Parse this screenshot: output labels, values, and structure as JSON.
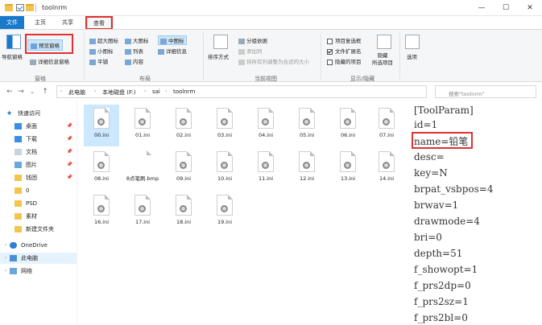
{
  "window": {
    "title": "toolnrm",
    "minimize": "—",
    "maximize": "☐",
    "close": "✕"
  },
  "ribbon_tabs": [
    {
      "label": "文件"
    },
    {
      "label": "主页"
    },
    {
      "label": "共享"
    },
    {
      "label": "查看"
    }
  ],
  "ribbon": {
    "panes": {
      "nav_pane": "导航窗格",
      "preview_pane": "预览窗格",
      "details_pane": "详细信息窗格",
      "group_label": "窗格"
    },
    "layout": {
      "xl_icons": "超大图标",
      "large_icons": "大图标",
      "medium_icons": "中图标",
      "small_icons": "小图标",
      "list": "列表",
      "details": "详细信息",
      "tiles": "平铺",
      "content": "内容",
      "group_label": "布局"
    },
    "current_view": {
      "sort_by": "排序方式",
      "group_by": "分组依据",
      "add_columns": "添加列",
      "size_all_columns": "将所有列调整为合适的大小",
      "group_label": "当前视图"
    },
    "show_hide": {
      "item_checkboxes": "项目复选框",
      "file_extensions": "文件扩展名",
      "hidden_items": "隐藏的项目",
      "hide_selected": "隐藏\n所选项目",
      "group_label": "显示/隐藏"
    },
    "options": "选项"
  },
  "address": {
    "crumbs": [
      "此电脑",
      "本地磁盘 (F:)",
      "sai",
      "toolnrm"
    ],
    "search_placeholder": "搜索\"toolnrm\""
  },
  "sidebar": {
    "items": [
      {
        "label": "快速访问",
        "pin": ""
      },
      {
        "label": "桌面",
        "pin": "📌"
      },
      {
        "label": "下载",
        "pin": "📌"
      },
      {
        "label": "文档",
        "pin": "📌"
      },
      {
        "label": "图片",
        "pin": "📌"
      },
      {
        "label": "钱团",
        "pin": "📌"
      },
      {
        "label": "0",
        "pin": ""
      },
      {
        "label": "PSD",
        "pin": ""
      },
      {
        "label": "素材",
        "pin": ""
      },
      {
        "label": "新建文件夹",
        "pin": ""
      },
      {
        "label": "OneDrive",
        "pin": ""
      },
      {
        "label": "此电脑",
        "pin": ""
      },
      {
        "label": "网络",
        "pin": ""
      }
    ]
  },
  "files": [
    "00.ini",
    "01.ini",
    "02.ini",
    "03.ini",
    "04.ini",
    "05.ini",
    "06.ini",
    "07.ini",
    "08.ini",
    "8点笔刷.bmp",
    "09.ini",
    "10.ini",
    "11.ini",
    "12.ini",
    "13.ini",
    "14.ini",
    "16.ini",
    "17.ini",
    "18.ini",
    "19.ini"
  ],
  "preview_text": [
    "[ToolParam]",
    "id=1",
    "name=铅笔",
    "desc=",
    "key=N",
    "brpat_vsbpos=4",
    "brwav=1",
    "drawmode=4",
    "bri=0",
    "depth=51",
    "f_showopt=1",
    "f_prs2dp=0",
    "f_prs2sz=1",
    "f_prs2bl=0"
  ],
  "colors": {
    "accent": "#1979ca",
    "highlight_box": "#e03030",
    "selection": "#cce8ff"
  }
}
